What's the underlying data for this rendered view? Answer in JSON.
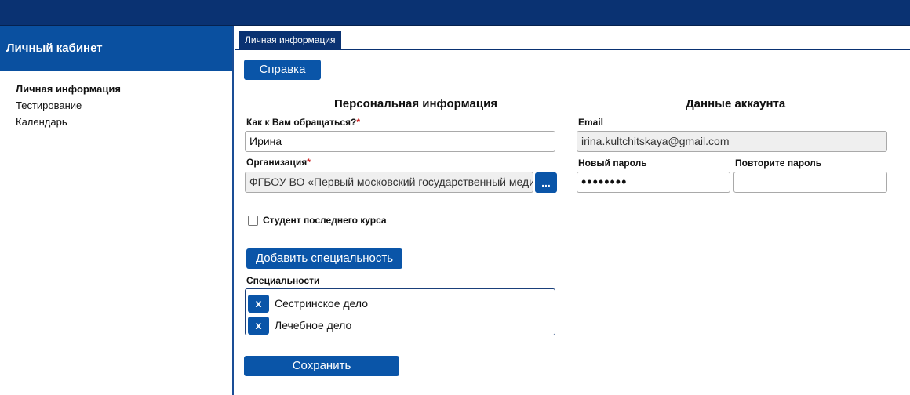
{
  "sidebar": {
    "title": "Личный кабинет",
    "items": [
      {
        "label": "Личная информация",
        "active": true
      },
      {
        "label": "Тестирование",
        "active": false
      },
      {
        "label": "Календарь",
        "active": false
      }
    ]
  },
  "main": {
    "tab_label": "Личная информация",
    "help_button": "Справка",
    "personal": {
      "title": "Персональная информация",
      "name_label": "Как к Вам обращаться?",
      "name_value": "Ирина",
      "org_label": "Организация",
      "org_value": "ФГБОУ ВО «Первый московский государственный медицинский",
      "org_button": "...",
      "student_checkbox_label": "Студент последнего курса",
      "student_checked": false,
      "required_mark": "*"
    },
    "account": {
      "title": "Данные аккаунта",
      "email_label": "Email",
      "email_value": "irina.kultchitskaya@gmail.com",
      "new_password_label": "Новый пароль",
      "new_password_value": "••••••••",
      "repeat_password_label": "Повторите пароль",
      "repeat_password_value": ""
    },
    "add_specialty_button": "Добавить специальность",
    "specialties_label": "Специальности",
    "specialties": [
      {
        "remove": "x",
        "name": "Сестринское дело"
      },
      {
        "remove": "x",
        "name": "Лечебное дело"
      }
    ],
    "save_button": "Сохранить"
  },
  "colors": {
    "topbar": "#0a3272",
    "accent": "#0a55a8",
    "sidebar_header": "#0a50a0",
    "required": "#cc2222"
  }
}
